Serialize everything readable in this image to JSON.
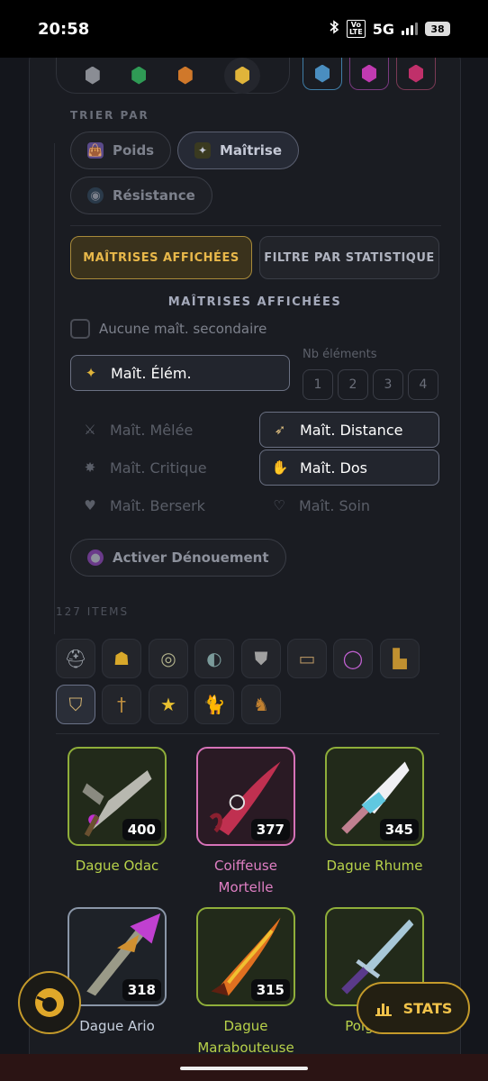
{
  "status_bar": {
    "time": "20:58",
    "network": "5G",
    "volte": "Vo\nLTE",
    "battery": "38"
  },
  "sort": {
    "label": "TRIER PAR",
    "options": [
      {
        "label": "Poids",
        "active": false,
        "icon": "weight-bag-icon"
      },
      {
        "label": "Maîtrise",
        "active": true,
        "icon": "mastery-icon"
      },
      {
        "label": "Résistance",
        "active": false,
        "icon": "resistance-icon"
      }
    ]
  },
  "tabs": {
    "shown": "MAÎTRISES AFFICHÉES",
    "filter": "FILTRE PAR STATISTIQUE"
  },
  "masteries": {
    "heading": "MAÎTRISES AFFICHÉES",
    "no_secondary": "Aucune maît. secondaire",
    "nb_elements_label": "Nb éléments",
    "nb_elements": [
      "1",
      "2",
      "3",
      "4"
    ],
    "elemental": "Maît. Élém.",
    "melee": "Maît. Mêlée",
    "distance": "Maît. Distance",
    "critical": "Maît. Critique",
    "back": "Maît. Dos",
    "berserk": "Maît. Berserk",
    "heal": "Maît. Soin",
    "denouement": "Activer Dénouement"
  },
  "items_count": "127 ITEMS",
  "categories": [
    "helmet-icon",
    "cape-icon",
    "amulet-icon",
    "shoulders-icon",
    "chest-icon",
    "belt-icon",
    "ring-icon",
    "boots-icon",
    "shield-icon",
    "dagger-icon",
    "star-icon",
    "pet-icon",
    "mount-icon"
  ],
  "items": [
    {
      "name": "Dague Odac",
      "level": "400",
      "border": "#8fae3a",
      "name_color": "#b8d24a"
    },
    {
      "name": "Coiffeuse Mortelle",
      "level": "377",
      "border": "#d672b8",
      "name_color": "#e07fc4"
    },
    {
      "name": "Dague Rhume",
      "level": "345",
      "border": "#8fae3a",
      "name_color": "#b8d24a"
    },
    {
      "name": "Dague Ario",
      "level": "318",
      "border": "#8a96a8",
      "name_color": "#c7d0de"
    },
    {
      "name": "Dague Marabouteuse",
      "level": "315",
      "border": "#8fae3a",
      "name_color": "#b8d24a"
    },
    {
      "name": "Poignard",
      "level": "",
      "border": "#8fae3a",
      "name_color": "#b8d24a"
    }
  ],
  "stats_button": "STATS"
}
